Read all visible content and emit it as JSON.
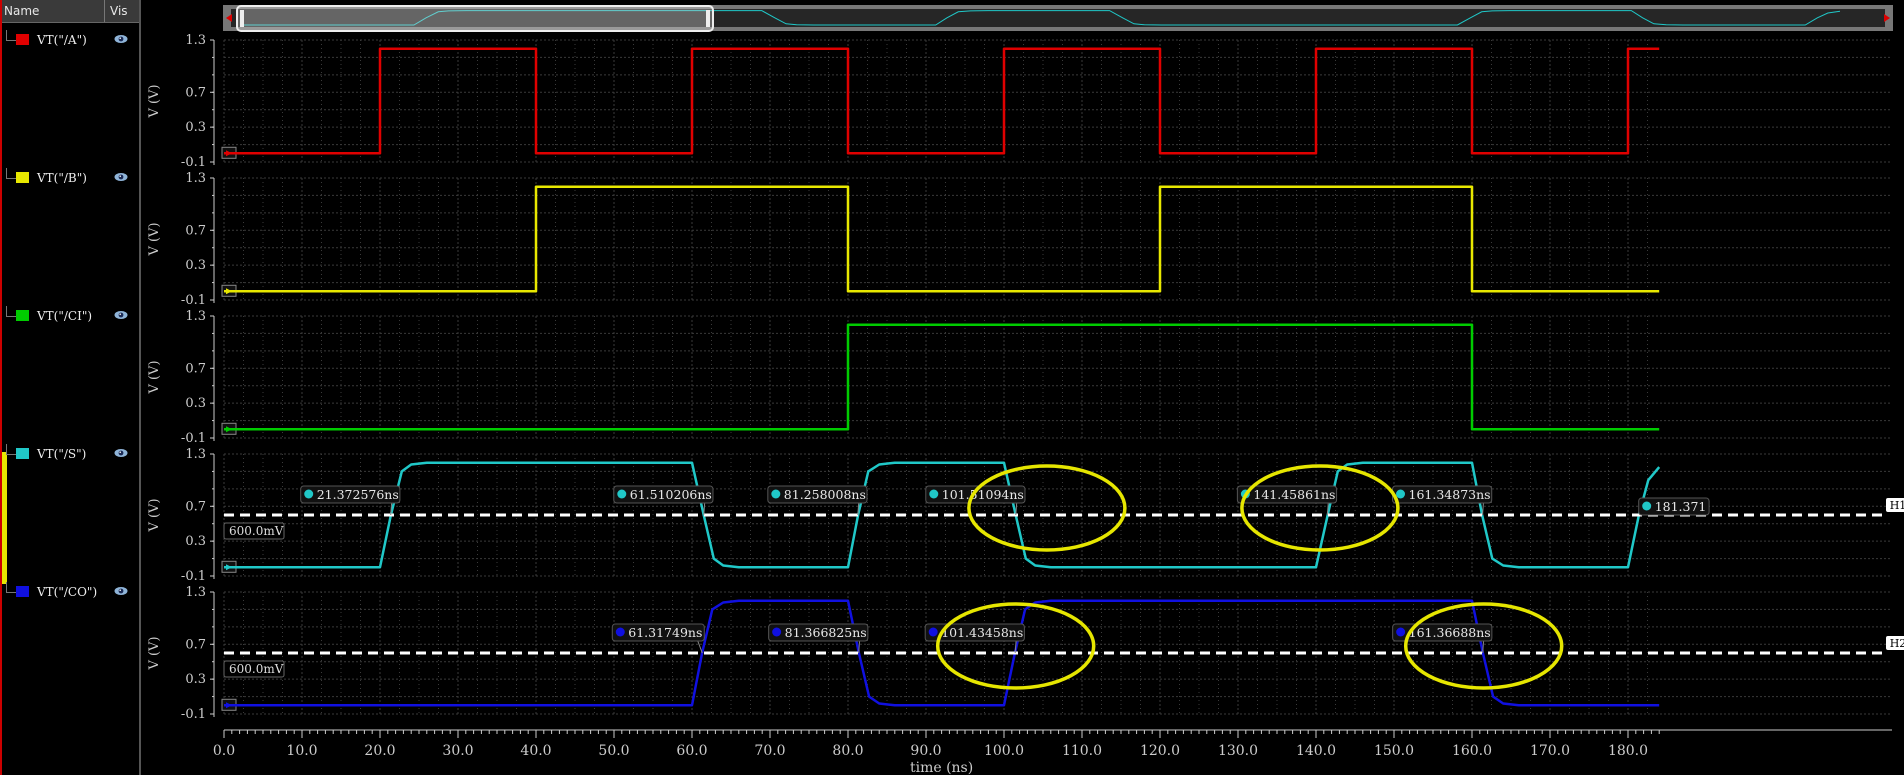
{
  "panel_header": {
    "name": "Name",
    "vis": "Vis"
  },
  "signals": [
    {
      "label": "VT(\"/A\")",
      "color": "#e00000",
      "icon": "eye-icon"
    },
    {
      "label": "VT(\"/B\")",
      "color": "#e8e800",
      "icon": "eye-icon"
    },
    {
      "label": "VT(\"/CI\")",
      "color": "#00cc00",
      "icon": "eye-icon"
    },
    {
      "label": "VT(\"/S\")",
      "color": "#20c8c8",
      "icon": "eye-icon"
    },
    {
      "label": "VT(\"/CO\")",
      "color": "#1010e0",
      "icon": "eye-icon"
    }
  ],
  "colors": {
    "grid": "#3a3a3a",
    "axis": "#cccccc",
    "highlight": "#e6e600",
    "background": "#000000"
  },
  "chart_data": {
    "type": "line",
    "xlabel": "time (ns)",
    "ylabel": "V (V)",
    "xlim": [
      0,
      184
    ],
    "ylim": [
      -0.1,
      1.3
    ],
    "x_ticks": [
      0,
      10,
      20,
      30,
      40,
      50,
      60,
      70,
      80,
      90,
      100,
      110,
      120,
      130,
      140,
      150,
      160,
      170,
      180
    ],
    "x_tick_labels": [
      "0.0",
      "10.0",
      "20.0",
      "30.0",
      "40.0",
      "50.0",
      "60.0",
      "70.0",
      "80.0",
      "90.0",
      "100.0",
      "110.0",
      "120.0",
      "130.0",
      "140.0",
      "150.0",
      "160.0",
      "170.0",
      "180.0"
    ],
    "y_ticks": [
      1.3,
      0.7,
      0.3,
      -0.1
    ],
    "y_tick_labels": [
      "1.3",
      "0.7",
      "0.3",
      "-0.1"
    ],
    "grid": true,
    "subplots": [
      {
        "name": "VT(\"/A\")",
        "color": "#e00000",
        "x": [
          0,
          20,
          20,
          40,
          40,
          60,
          60,
          80,
          80,
          100,
          100,
          120,
          120,
          140,
          140,
          160,
          160,
          180,
          180,
          184
        ],
        "y": [
          0,
          0,
          1.2,
          1.2,
          0,
          0,
          1.2,
          1.2,
          0,
          0,
          1.2,
          1.2,
          0,
          0,
          1.2,
          1.2,
          0,
          0,
          1.2,
          1.2
        ]
      },
      {
        "name": "VT(\"/B\")",
        "color": "#e8e800",
        "x": [
          0,
          40,
          40,
          80,
          80,
          120,
          120,
          160,
          160,
          184
        ],
        "y": [
          0,
          0,
          1.2,
          1.2,
          0,
          0,
          1.2,
          1.2,
          0,
          0
        ]
      },
      {
        "name": "VT(\"/CI\")",
        "color": "#00cc00",
        "x": [
          0,
          80,
          80,
          160,
          160,
          184
        ],
        "y": [
          0,
          0,
          1.2,
          1.2,
          0,
          0
        ]
      },
      {
        "name": "VT(\"/S\")",
        "color": "#20c8c8",
        "x": [
          0,
          20,
          21.4,
          22.8,
          24,
          26,
          60,
          61.5,
          62.8,
          64,
          66,
          80,
          81.3,
          82.6,
          84,
          86,
          100,
          101.5,
          102.8,
          104,
          106,
          140,
          141.5,
          142.8,
          144,
          146,
          160,
          161.3,
          162.6,
          164,
          166,
          180,
          181.4,
          182.6,
          184
        ],
        "y": [
          0,
          0,
          0.6,
          1.1,
          1.18,
          1.2,
          1.2,
          0.6,
          0.1,
          0.02,
          0,
          0,
          0.6,
          1.1,
          1.18,
          1.2,
          1.2,
          0.6,
          0.1,
          0.02,
          0,
          0,
          0.6,
          1.1,
          1.18,
          1.2,
          1.2,
          0.6,
          0.1,
          0.02,
          0,
          0,
          0.6,
          1.0,
          1.15
        ]
      },
      {
        "name": "VT(\"/CO\")",
        "color": "#1010e0",
        "x": [
          0,
          60,
          61.3,
          62.6,
          64,
          66,
          80,
          81.4,
          82.7,
          84,
          86,
          100,
          101.4,
          102.7,
          104,
          106,
          160,
          161.4,
          162.7,
          164,
          166,
          184
        ],
        "y": [
          0,
          0,
          0.6,
          1.1,
          1.18,
          1.2,
          1.2,
          0.6,
          0.1,
          0.02,
          0,
          0,
          0.6,
          1.1,
          1.18,
          1.2,
          1.2,
          0.6,
          0.1,
          0.02,
          0,
          0
        ]
      }
    ],
    "horizontal_markers": [
      {
        "subplot": 3,
        "name": "H1",
        "value": 0.6,
        "label": "600.0mV"
      },
      {
        "subplot": 4,
        "name": "H2",
        "value": 0.6,
        "label": "600.0mV"
      }
    ],
    "crossings": [
      {
        "subplot": 3,
        "x": 21.372576,
        "label": "21.372576ns"
      },
      {
        "subplot": 3,
        "x": 61.510206,
        "label": "61.510206ns"
      },
      {
        "subplot": 3,
        "x": 81.258008,
        "label": "81.258008ns"
      },
      {
        "subplot": 3,
        "x": 101.51094,
        "label": "101.51094ns"
      },
      {
        "subplot": 3,
        "x": 141.45861,
        "label": "141.45861ns"
      },
      {
        "subplot": 3,
        "x": 161.34873,
        "label": "161.34873ns"
      },
      {
        "subplot": 3,
        "x": 181.371,
        "label": "181.371"
      },
      {
        "subplot": 4,
        "x": 61.31749,
        "label": "61.31749ns"
      },
      {
        "subplot": 4,
        "x": 81.366825,
        "label": "81.366825ns"
      },
      {
        "subplot": 4,
        "x": 101.43458,
        "label": "101.43458ns"
      },
      {
        "subplot": 4,
        "x": 161.36688,
        "label": "161.36688ns"
      }
    ],
    "highlight_ellipses": [
      {
        "subplot": 3,
        "x": 105.5,
        "y": 0.6
      },
      {
        "subplot": 3,
        "x": 140.5,
        "y": 0.6
      },
      {
        "subplot": 4,
        "x": 101.5,
        "y": 0.6
      },
      {
        "subplot": 4,
        "x": 161.5,
        "y": 0.6
      }
    ]
  }
}
